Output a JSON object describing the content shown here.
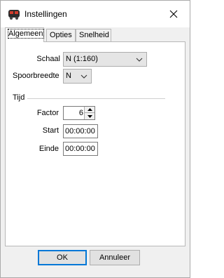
{
  "window": {
    "title": "Instellingen",
    "icon": "train-icon"
  },
  "tabs": [
    {
      "label": "Algemeen",
      "active": true
    },
    {
      "label": "Opties",
      "active": false
    },
    {
      "label": "Snelheid",
      "active": false
    }
  ],
  "general": {
    "scale_label": "Schaal",
    "scale_value": "N (1:160)",
    "gauge_label": "Spoorbreedte",
    "gauge_value": "N"
  },
  "time": {
    "group_title": "Tijd",
    "factor_label": "Factor",
    "factor_value": "6",
    "start_label": "Start",
    "start_value": "00:00:00",
    "end_label": "Einde",
    "end_value": "00:00:00"
  },
  "buttons": {
    "ok": "OK",
    "cancel": "Annuleer"
  }
}
